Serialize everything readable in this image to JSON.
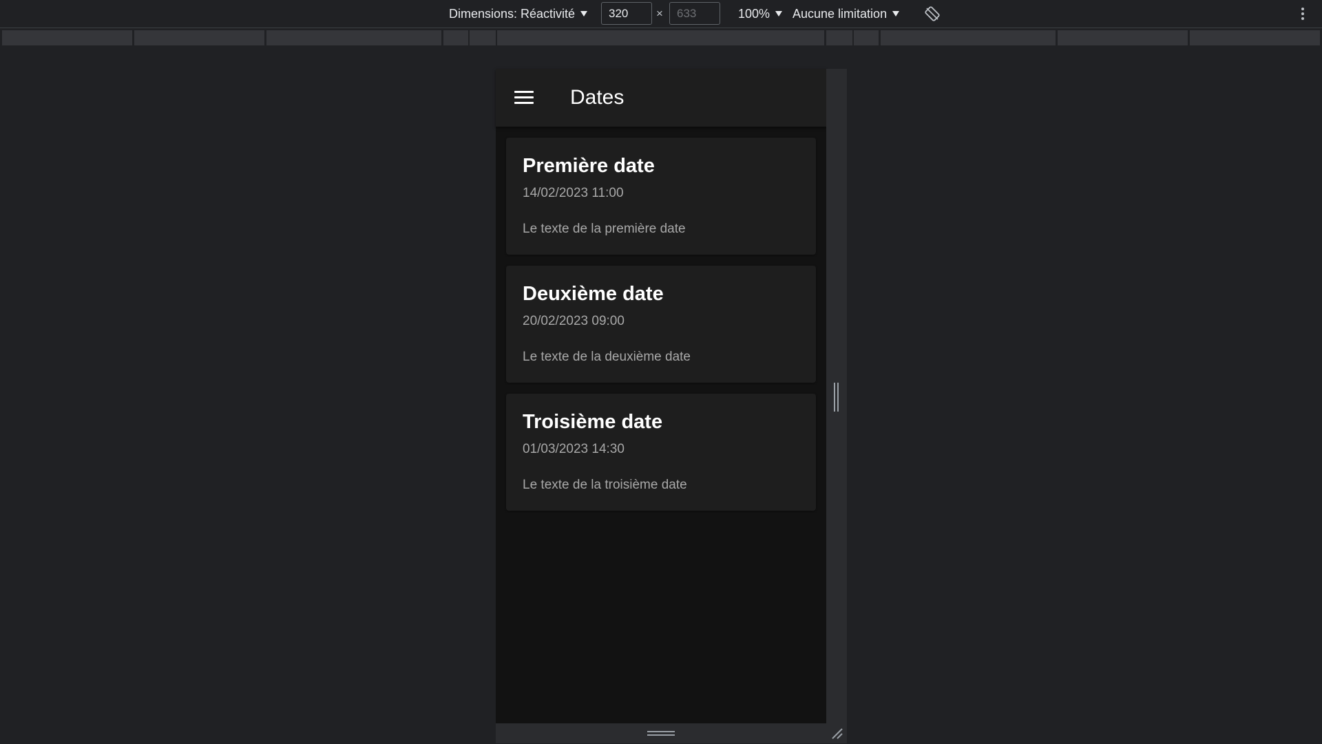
{
  "toolbar": {
    "dimensions_label": "Dimensions: Réactivité",
    "width_value": "320",
    "height_placeholder": "633",
    "times": "×",
    "zoom_label": "100%",
    "throttle_label": "Aucune limitation",
    "rotate_icon": "rotate-icon",
    "more_icon": "more-vert-icon"
  },
  "app": {
    "title": "Dates",
    "menu_icon": "hamburger-menu-icon",
    "header_bg": "#1e1e1e",
    "page_bg": "#121212"
  },
  "cards": [
    {
      "title": "Première date",
      "date": "14/02/2023 11:00",
      "text": "Le texte de la première date"
    },
    {
      "title": "Deuxième date",
      "date": "20/02/2023 09:00",
      "text": "Le texte de la deuxième date"
    },
    {
      "title": "Troisième date",
      "date": "01/03/2023 14:30",
      "text": "Le texte de la troisième date"
    }
  ]
}
